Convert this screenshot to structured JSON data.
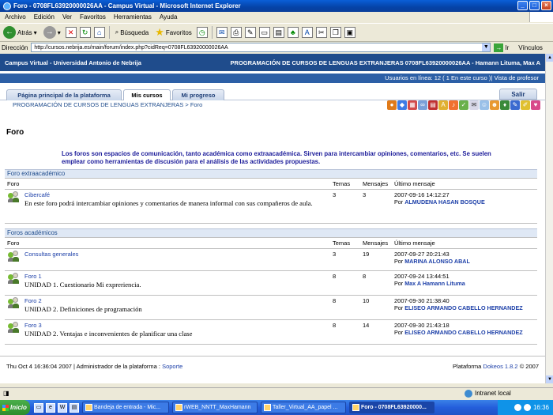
{
  "window": {
    "title": "Foro - 0708FL63920000026AA - Campus Virtual - Microsoft Internet Explorer"
  },
  "menubar": [
    "Archivo",
    "Edición",
    "Ver",
    "Favoritos",
    "Herramientas",
    "Ayuda"
  ],
  "toolbar": {
    "back": "Atrás",
    "search": "Búsqueda",
    "favorites": "Favoritos"
  },
  "address": {
    "label": "Dirección",
    "url": "http://cursos.nebrija.es/main/forum/index.php?cidReq=0708FL63920000026AA",
    "go": "Ir",
    "links": "Vínculos"
  },
  "site": {
    "left": "Campus Virtual - Universidad Antonio de Nebrija",
    "right": "PROGRAMACIÓN DE CURSOS DE LENGUAS EXTRANJERAS 0708FL63920000026AA - Hamann Lituma, Max A",
    "users_online": "Usuarios en línea:  12  ( 1 En este curso )| Vista de profesor"
  },
  "tabs": {
    "home": "Página principal de la plataforma",
    "courses": "Mis cursos",
    "progress": "Mi progreso",
    "logout": "Salir"
  },
  "breadcrumb": "PROGRAMACIÓN DE CURSOS DE LENGUAS EXTRANJERAS > Foro",
  "page_title": "Foro",
  "intro": "Los foros son espacios de comunicación, tanto académica como extraacadémica. Sirven para intercambiar opiniones, comentarios, etc. Se suelen emplear como herramientas de discusión para el análisis de las actividades propuestas.",
  "columns": {
    "forum": "Foro",
    "topics": "Temas",
    "posts": "Mensajes",
    "last": "Último mensaje"
  },
  "categories": [
    {
      "name": "Foro extraacadémico",
      "forums": [
        {
          "title": "Cibercafé",
          "desc": "En este foro podrá intercambiar opiniones y comentarios de manera informal con sus compañeros de aula.",
          "topics": "3",
          "posts": "3",
          "last_date": "2007-09-16 14:12:27",
          "last_by_prefix": "Por",
          "last_by": "ALMUDENA HASAN BOSQUE"
        }
      ]
    },
    {
      "name": "Foros académicos",
      "forums": [
        {
          "title": "Consultas generales",
          "desc": "",
          "topics": "3",
          "posts": "19",
          "last_date": "2007-09-27 20:21:43",
          "last_by_prefix": "Por",
          "last_by": "MARINA ALONSO ABAL"
        },
        {
          "title": "Foro 1",
          "desc": "UNIDAD 1. Cuestionario Mi expreriencia.",
          "topics": "8",
          "posts": "8",
          "last_date": "2007-09-24 13:44:51",
          "last_by_prefix": "Por",
          "last_by": "Max A Hamann Lituma"
        },
        {
          "title": "Foro 2",
          "desc": "UNIDAD 2. Definiciones de programación",
          "topics": "8",
          "posts": "10",
          "last_date": "2007-09-30 21:38:40",
          "last_by_prefix": "Por",
          "last_by": "ELISEO ARMANDO CABELLO HERNANDEZ"
        },
        {
          "title": "Foro 3",
          "desc": "UNIDAD 2. Ventajas e inconvenientes de planificar una clase",
          "topics": "8",
          "posts": "14",
          "last_date": "2007-09-30 21:43:18",
          "last_by_prefix": "Por",
          "last_by": "ELISEO ARMANDO CABELLO HERNANDEZ"
        }
      ]
    }
  ],
  "footer": {
    "left": "Thu Oct 4 16:36:04 2007 | Administrador de la plataforma : ",
    "support": "Soporte",
    "right_prefix": "Plataforma ",
    "right_link": "Dokeos 1.8.2",
    "right_suffix": " © 2007"
  },
  "status": {
    "zone": "Intranet local"
  },
  "taskbar": {
    "start": "Inicio",
    "tasks": [
      "Bandeja de entrada - Mic...",
      "rWEB_NNTT_MaxHamann",
      "Taller_Virtual_AA_papel ...",
      "Foro - 0708FL63920000..."
    ],
    "clock": "16:36"
  }
}
